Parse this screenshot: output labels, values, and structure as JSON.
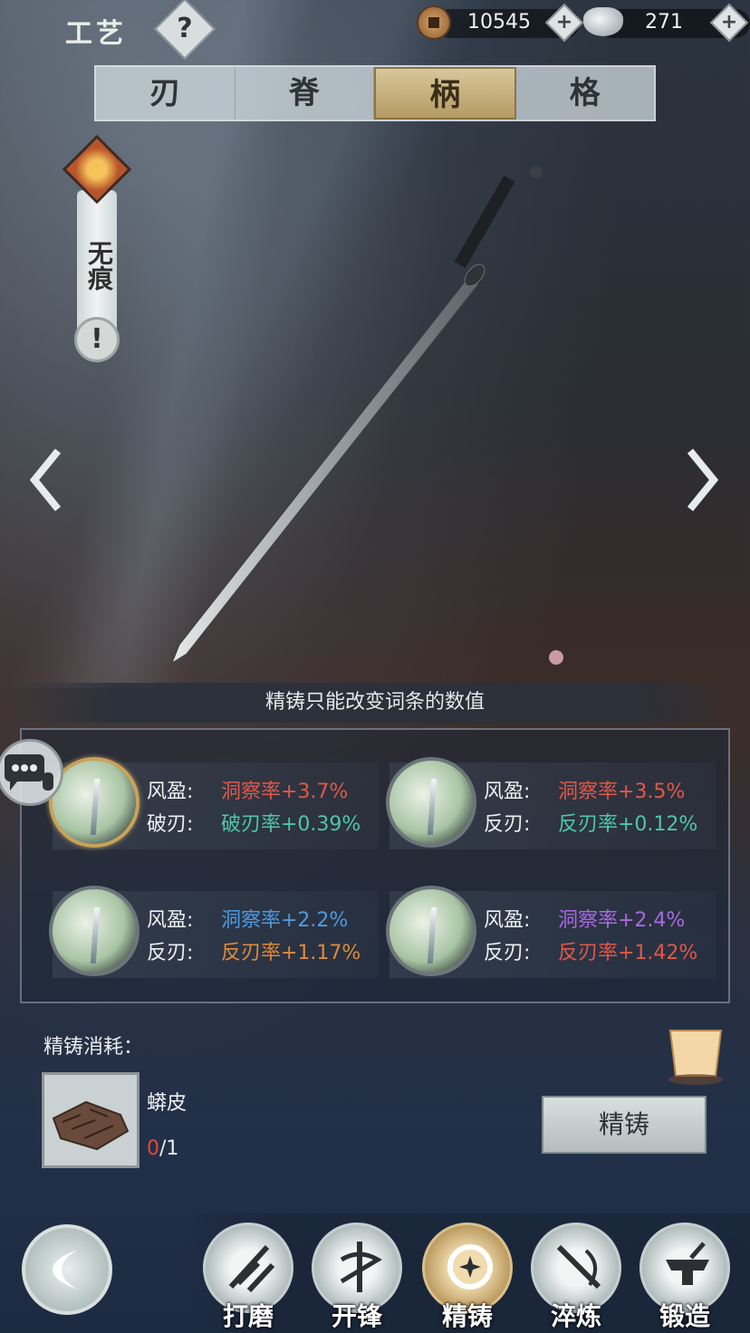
{
  "header": {
    "title": "工艺",
    "help_glyph": "?",
    "copper": {
      "icon": "copper-coin-icon",
      "value": "10545",
      "plus": "+"
    },
    "silver": {
      "icon": "silver-ingot-icon",
      "value": "271",
      "plus": "+"
    }
  },
  "tabs": [
    {
      "label": "刃",
      "active": false
    },
    {
      "label": "脊",
      "active": false
    },
    {
      "label": "柄",
      "active": true
    },
    {
      "label": "格",
      "active": false
    }
  ],
  "sidebar": {
    "name": "无痕",
    "warn_glyph": "!"
  },
  "notice": "精铸只能改变词条的数值",
  "options": [
    {
      "selected": true,
      "line1": {
        "label": "风盈:",
        "value": "洞察率+3.7%",
        "color": "#e0584a"
      },
      "line2": {
        "label": "破刃:",
        "value": "破刃率+0.39%",
        "color": "#4fc6a8"
      }
    },
    {
      "selected": false,
      "line1": {
        "label": "风盈:",
        "value": "洞察率+3.5%",
        "color": "#e0584a"
      },
      "line2": {
        "label": "反刃:",
        "value": "反刃率+0.12%",
        "color": "#4fc6a8"
      }
    },
    {
      "selected": false,
      "line1": {
        "label": "风盈:",
        "value": "洞察率+2.2%",
        "color": "#4f9ae0"
      },
      "line2": {
        "label": "反刃:",
        "value": "反刃率+1.17%",
        "color": "#e08a3a"
      }
    },
    {
      "selected": false,
      "line1": {
        "label": "风盈:",
        "value": "洞察率+2.4%",
        "color": "#a86ae0"
      },
      "line2": {
        "label": "反刃:",
        "value": "反刃率+1.42%",
        "color": "#e0584a"
      }
    }
  ],
  "cost": {
    "label": "精铸消耗：",
    "material": {
      "name": "蟒皮",
      "have": "0",
      "need": "/1"
    }
  },
  "forge_button": "精铸",
  "bottom_nav": [
    {
      "label": "打磨",
      "icon": "grind-icon",
      "active": false
    },
    {
      "label": "开锋",
      "icon": "sharpen-icon",
      "active": false
    },
    {
      "label": "精铸",
      "icon": "refine-icon",
      "active": true
    },
    {
      "label": "淬炼",
      "icon": "temper-icon",
      "active": false
    },
    {
      "label": "锻造",
      "icon": "forge-icon",
      "active": false
    }
  ]
}
